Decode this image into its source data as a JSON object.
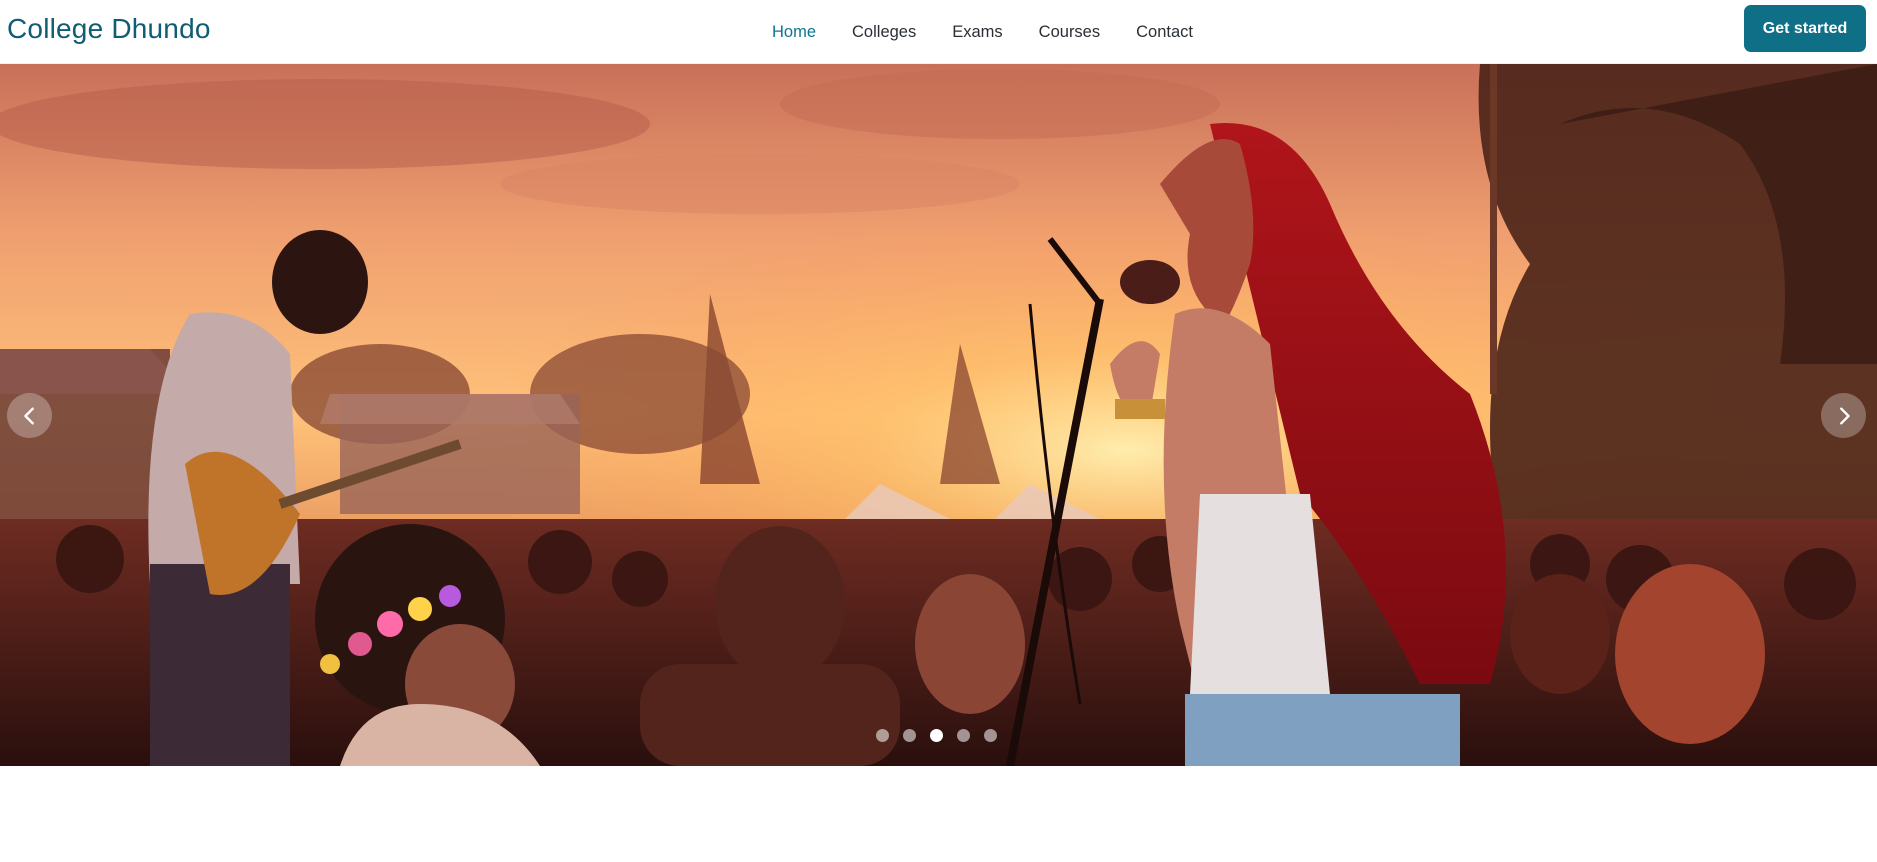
{
  "brand": {
    "name": "College Dhundo"
  },
  "nav": {
    "items": [
      {
        "label": "Home",
        "active": true
      },
      {
        "label": "Colleges",
        "active": false
      },
      {
        "label": "Exams",
        "active": false
      },
      {
        "label": "Courses",
        "active": false
      },
      {
        "label": "Contact",
        "active": false
      }
    ]
  },
  "header": {
    "cta_label": "Get started"
  },
  "carousel": {
    "image_description": "sunset music festival concert with guitarist, red-haired singer and crowd",
    "slide_count": 5,
    "active_slide": 3,
    "prev_icon": "chevron-left-icon",
    "next_icon": "chevron-right-icon"
  },
  "colors": {
    "brand": "#0f5c73",
    "nav_active": "#0e7490",
    "cta_background": "#0f6f86"
  }
}
